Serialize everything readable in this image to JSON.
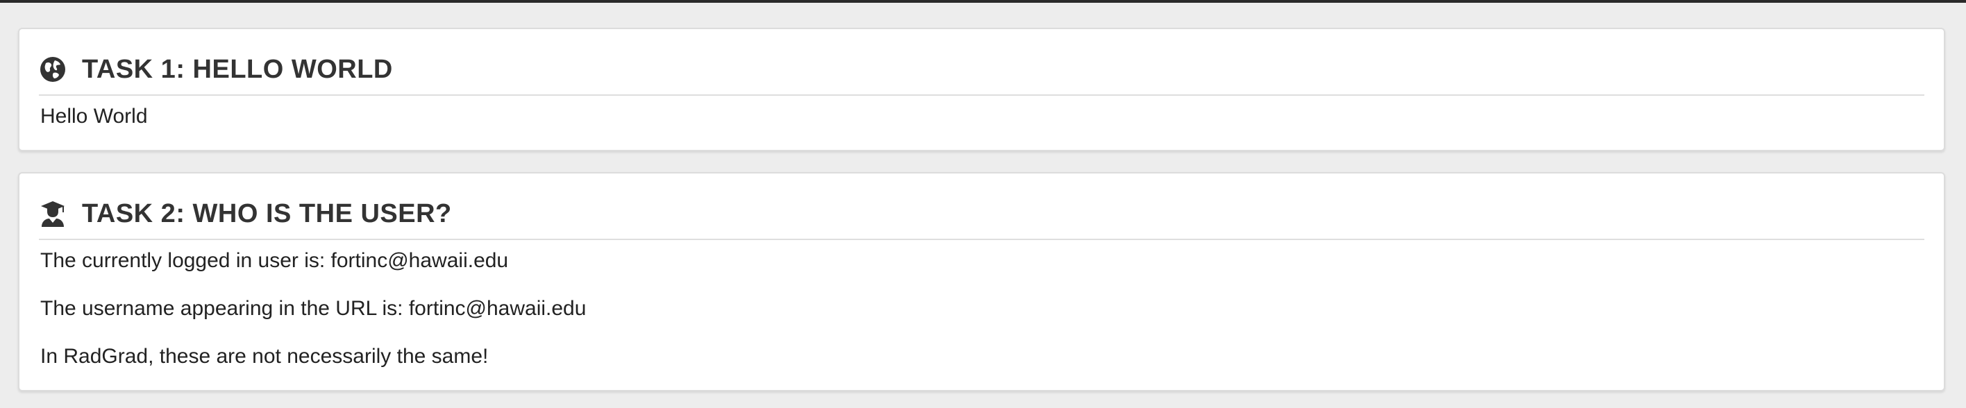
{
  "task1": {
    "icon": "globe-icon",
    "title": "TASK 1: HELLO WORLD",
    "body": "Hello World"
  },
  "task2": {
    "icon": "user-graduate-icon",
    "title": "TASK 2: WHO IS THE USER?",
    "lines": [
      "The currently logged in user is: fortinc@hawaii.edu",
      "The username appearing in the URL is: fortinc@hawaii.edu",
      "In RadGrad, these are not necessarily the same!"
    ]
  },
  "colors": {
    "page_background": "#ededed",
    "card_background": "#ffffff",
    "heading_text": "#333333",
    "body_text": "#222222"
  }
}
